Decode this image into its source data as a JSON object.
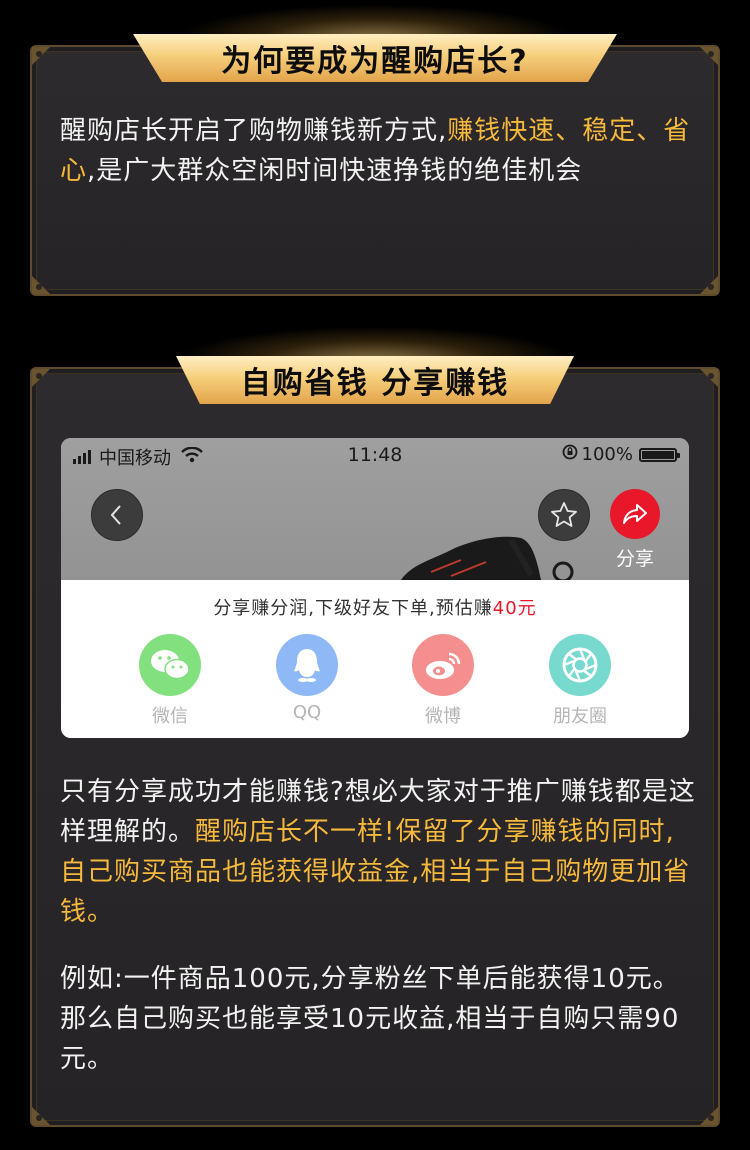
{
  "section1": {
    "title": "为何要成为醒购店长?",
    "text_a": "醒购店长开启了购物赚钱新方式,",
    "text_b": "赚钱快速、稳定、省心",
    "text_c": ",是广大群众空闲时间快速挣钱的绝佳机会"
  },
  "section2": {
    "title": "自购省钱 分享赚钱",
    "phone": {
      "carrier": "中国移动",
      "time": "11:48",
      "battery": "100%",
      "share_label": "分享",
      "earn_prefix": "分享赚分润,下级好友下单,预估赚",
      "earn_amount": "40元",
      "targets": [
        {
          "label": "微信",
          "icon": "wechat-icon",
          "color": "#82e07f"
        },
        {
          "label": "QQ",
          "icon": "qq-icon",
          "color": "#8fb8f6"
        },
        {
          "label": "微博",
          "icon": "weibo-icon",
          "color": "#f58f8f"
        },
        {
          "label": "朋友圈",
          "icon": "moments-icon",
          "color": "#78d9cf"
        }
      ]
    },
    "para1_a": "只有分享成功才能赚钱?想必大家对于推广赚钱都是这样理解的。",
    "para1_b": "醒购店长不一样!保留了分享赚钱的同时,自己购买商品也能获得收益金,相当于自己购物更加省钱。",
    "para2": "例如:一件商品100元,分享粉丝下单后能获得10元。那么自己购买也能享受10元收益,相当于自购只需90元。"
  },
  "colors": {
    "highlight": "#f6b93b",
    "banner_gold": "#f6cf7c",
    "panel_bg": "#2d2b2d",
    "share_red": "#e8182a"
  }
}
